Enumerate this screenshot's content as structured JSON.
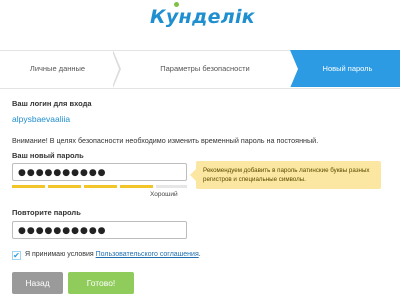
{
  "logo": {
    "text": "Кунделік"
  },
  "steps": [
    {
      "label": "Личные данные"
    },
    {
      "label": "Параметры безопасности"
    },
    {
      "label": "Новый пароль"
    }
  ],
  "login": {
    "label": "Ваш логин для входа",
    "value": "alpysbaevaaliia"
  },
  "notice": "Внимание! В целях безопасности необходимо изменить временный пароль на постоянный.",
  "new_password": {
    "label": "Ваш новый пароль",
    "value": "●●●●●●●●●●",
    "strength_label": "Хороший",
    "strength_level": "4/5"
  },
  "tooltip": {
    "text": "Рекомендуем добавить в пароль латинские буквы разных регистров и специальные символы."
  },
  "repeat_password": {
    "label": "Повторите пароль",
    "value": "●●●●●●●●●●"
  },
  "agreement": {
    "checked": true,
    "prefix": "Я принимаю условия ",
    "link": "Пользовательского соглашения",
    "suffix": "."
  },
  "buttons": {
    "back": "Назад",
    "done": "Готово!"
  },
  "colors": {
    "accent": "#2d9be4",
    "strength": "#f2c52b",
    "tooltip_bg": "#fbe7a1",
    "back_button": "#9a9a9a",
    "done_button": "#8fcc5c"
  }
}
